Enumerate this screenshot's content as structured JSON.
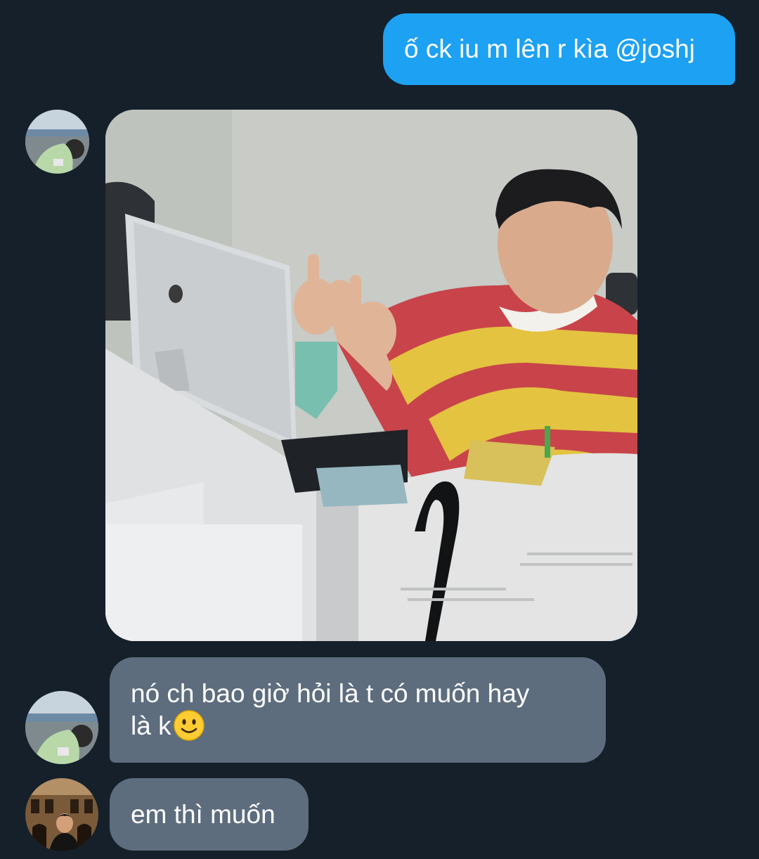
{
  "messages": {
    "outgoing_1": "ố ck iu m lên r kìa @joshj",
    "incoming_1_line1": "nó ch bao giờ hỏi là t có muốn hay",
    "incoming_1_line2": "là k",
    "incoming_2": "em thì muốn"
  },
  "icons": {
    "emoji": "slightly-smiling-face-icon"
  },
  "colors": {
    "background": "#15202b",
    "outgoing_bubble": "#1da1f2",
    "incoming_bubble": "#5d6d7e",
    "text": "#ffffff"
  }
}
